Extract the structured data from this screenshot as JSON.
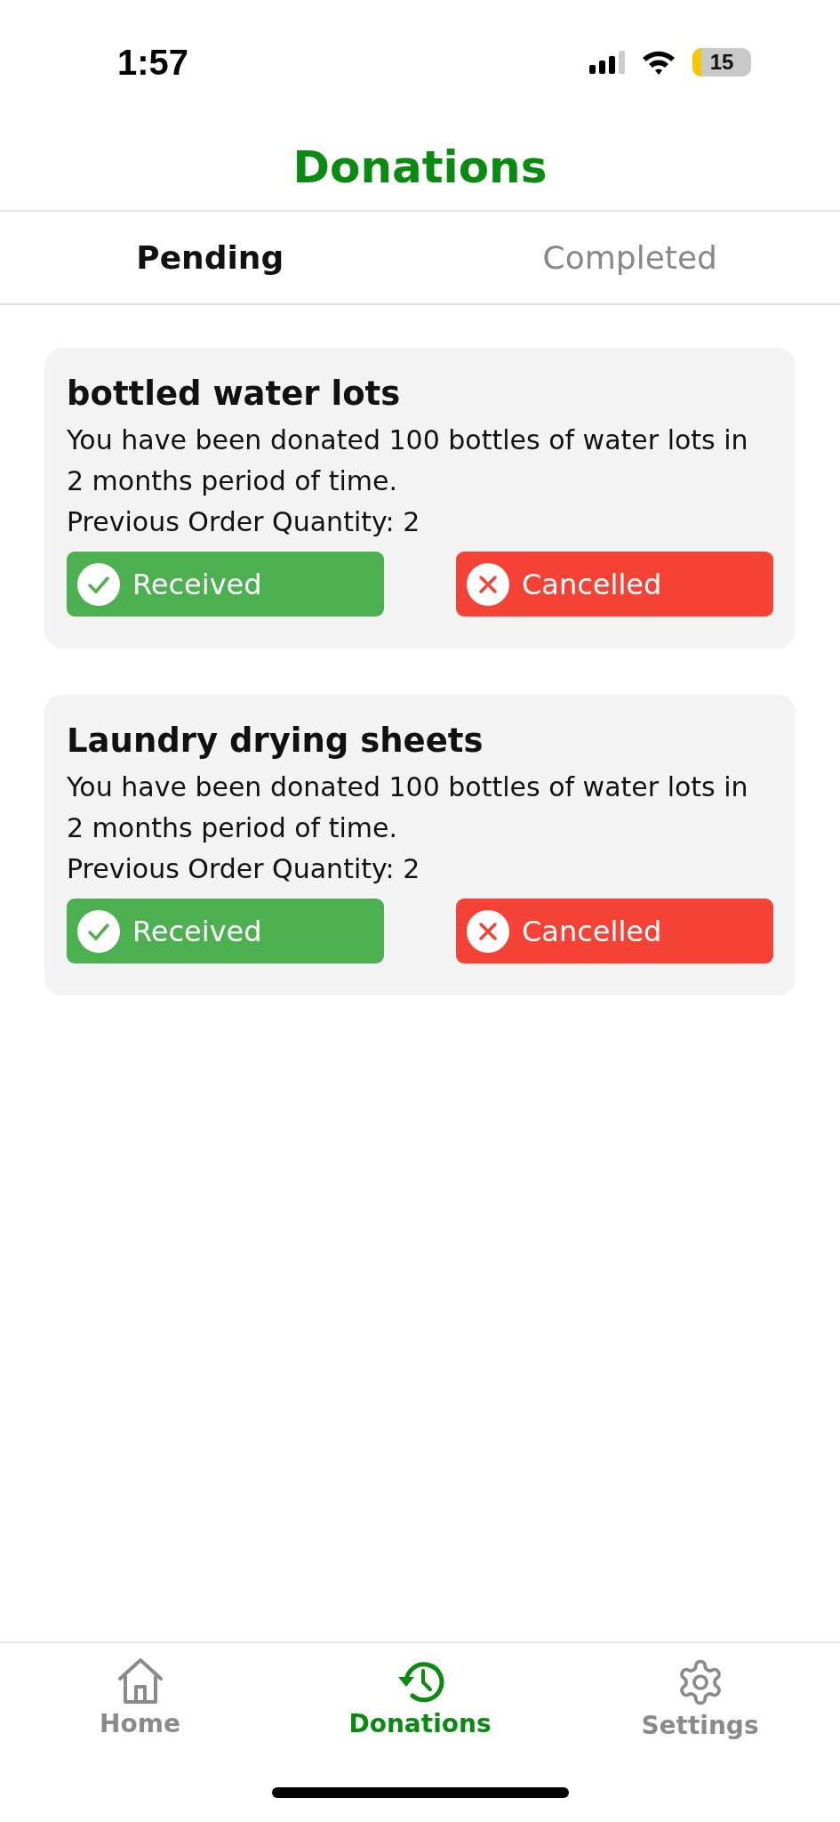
{
  "status_bar": {
    "time": "1:57",
    "battery": "15"
  },
  "header": {
    "title": "Donations"
  },
  "tabs": [
    {
      "label": "Pending",
      "selected": true
    },
    {
      "label": "Completed",
      "selected": false
    }
  ],
  "donations": [
    {
      "title": "bottled water lots",
      "description": "You have been donated 100 bottles of water lots in 2 months period of time.",
      "quantity": "Previous Order Quantity: 2",
      "actions": [
        {
          "label": "Received",
          "kind": "accept"
        },
        {
          "label": "Cancelled",
          "kind": "cancel"
        }
      ]
    },
    {
      "title": "Laundry drying sheets",
      "description": "You have been donated 100 bottles of water lots in 2 months period of time.",
      "quantity": "Previous Order Quantity: 2",
      "actions": [
        {
          "label": "Received",
          "kind": "accept"
        },
        {
          "label": "Cancelled",
          "kind": "cancel"
        }
      ]
    }
  ],
  "bottom_nav": [
    {
      "label": "Home",
      "kind": "home",
      "selected": false
    },
    {
      "label": "Donations",
      "kind": "history",
      "selected": true
    },
    {
      "label": "Settings",
      "kind": "settings",
      "selected": false
    }
  ]
}
